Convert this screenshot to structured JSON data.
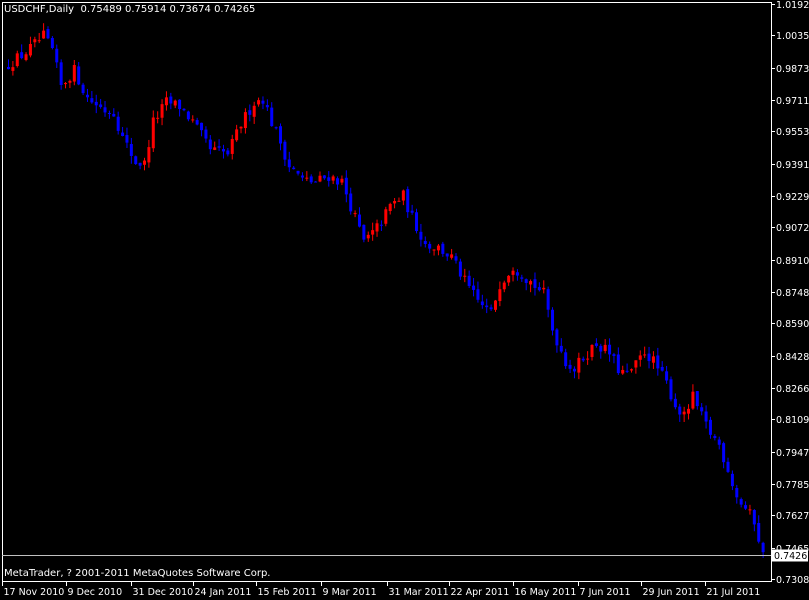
{
  "title": {
    "symbol_label": "USDCHF,Daily",
    "ohlc": "0.75489 0.75914 0.73674 0.74265"
  },
  "copyright": "MetaTrader, ? 2001-2011 MetaQuotes Software Corp.",
  "colors": {
    "background": "#000000",
    "foreground": "#ffffff",
    "bull_candle": "#ff0000",
    "bear_candle": "#0000ff",
    "bid_line": "#c0c0c0"
  },
  "chart_data": {
    "type": "candlestick",
    "grid": false,
    "ylim": [
      0.7308,
      1.01925
    ],
    "y_ticks": [
      "1.01925",
      "1.00350",
      "0.98730",
      "0.97110",
      "0.95535",
      "0.93915",
      "0.92295",
      "0.90720",
      "0.89100",
      "0.87480",
      "0.85905",
      "0.84285",
      "0.82665",
      "0.81090",
      "0.79470",
      "0.77850",
      "0.76275",
      "0.74655",
      "0.73080"
    ],
    "x_ticks": [
      "17 Nov 2010",
      "9 Dec 2010",
      "31 Dec 2010",
      "24 Jan 2011",
      "15 Feb 2011",
      "9 Mar 2011",
      "31 Mar 2011",
      "22 Apr 2011",
      "16 May 2011",
      "7 Jun 2011",
      "29 Jun 2011",
      "21 Jul 2011"
    ],
    "current_price": "0.74265",
    "close_trend": [
      [
        0,
        0.989
      ],
      [
        4,
        0.995
      ],
      [
        8,
        1.003
      ],
      [
        10,
        0.996
      ],
      [
        12,
        0.978
      ],
      [
        15,
        0.986
      ],
      [
        18,
        0.972
      ],
      [
        22,
        0.966
      ],
      [
        24,
        0.965
      ],
      [
        26,
        0.952
      ],
      [
        29,
        0.94
      ],
      [
        31,
        0.939
      ],
      [
        33,
        0.96
      ],
      [
        36,
        0.97
      ],
      [
        39,
        0.968
      ],
      [
        42,
        0.96
      ],
      [
        44,
        0.953
      ],
      [
        46,
        0.946
      ],
      [
        48,
        0.945
      ],
      [
        50,
        0.944
      ],
      [
        53,
        0.959
      ],
      [
        56,
        0.97
      ],
      [
        58,
        0.972
      ],
      [
        60,
        0.96
      ],
      [
        62,
        0.95
      ],
      [
        64,
        0.938
      ],
      [
        67,
        0.931
      ],
      [
        70,
        0.93
      ],
      [
        73,
        0.933
      ],
      [
        76,
        0.93
      ],
      [
        79,
        0.912
      ],
      [
        81,
        0.9
      ],
      [
        83,
        0.904
      ],
      [
        85,
        0.91
      ],
      [
        87,
        0.918
      ],
      [
        90,
        0.923
      ],
      [
        92,
        0.912
      ],
      [
        95,
        0.899
      ],
      [
        98,
        0.897
      ],
      [
        101,
        0.892
      ],
      [
        104,
        0.88
      ],
      [
        107,
        0.87
      ],
      [
        110,
        0.864
      ],
      [
        112,
        0.879
      ],
      [
        115,
        0.888
      ],
      [
        118,
        0.882
      ],
      [
        120,
        0.878
      ],
      [
        122,
        0.874
      ],
      [
        124,
        0.856
      ],
      [
        127,
        0.84
      ],
      [
        129,
        0.836
      ],
      [
        131,
        0.842
      ],
      [
        134,
        0.849
      ],
      [
        137,
        0.844
      ],
      [
        139,
        0.836
      ],
      [
        141,
        0.833
      ],
      [
        143,
        0.838
      ],
      [
        145,
        0.845
      ],
      [
        147,
        0.84
      ],
      [
        150,
        0.829
      ],
      [
        152,
        0.818
      ],
      [
        154,
        0.812
      ],
      [
        156,
        0.822
      ],
      [
        158,
        0.812
      ],
      [
        160,
        0.804
      ],
      [
        162,
        0.798
      ],
      [
        164,
        0.786
      ],
      [
        166,
        0.772
      ],
      [
        168,
        0.766
      ],
      [
        170,
        0.76
      ],
      [
        172,
        0.7427
      ]
    ]
  }
}
